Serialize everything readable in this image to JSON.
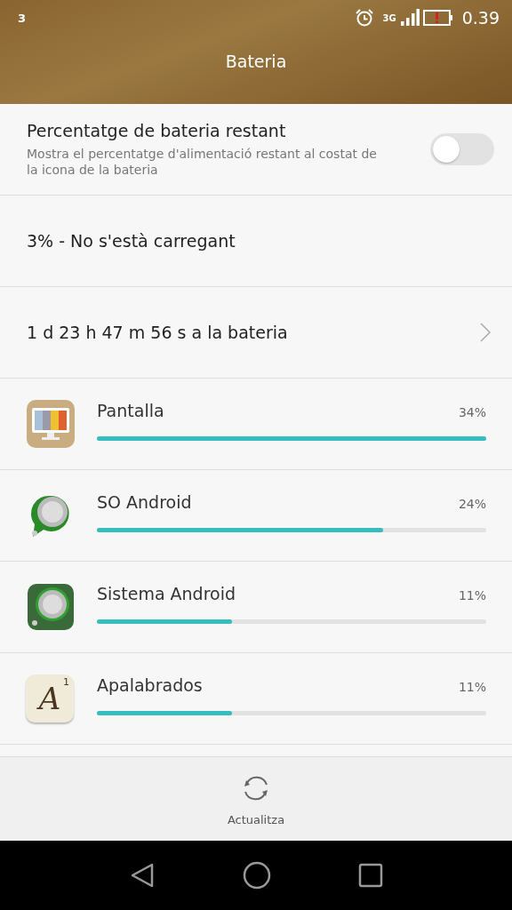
{
  "status_bar": {
    "notification": "3",
    "network": "3G",
    "time": "0.39"
  },
  "window": {
    "title": "Bateria"
  },
  "percentage_setting": {
    "title": "Percentatge de bateria restant",
    "description": "Mostra el percentatge d'alimentació restant al costat de la icona de la bateria",
    "on": false
  },
  "charge_status": "3% - No s'està carregant",
  "remaining_time": "1 d 23 h 47 m 56 s a la bateria",
  "apps": [
    {
      "name": "Pantalla",
      "percent": "34%",
      "level": 1.0,
      "kind": "monitor"
    },
    {
      "name": "SO Android",
      "percent": "24%",
      "level": 0.735,
      "kind": "disc-badge"
    },
    {
      "name": "Sistema Android",
      "percent": "11%",
      "level": 0.347,
      "kind": "disc-square"
    },
    {
      "name": "Apalabrados",
      "percent": "11%",
      "level": 0.347,
      "kind": "letter",
      "icon_letter": "A",
      "icon_mark": "1"
    }
  ],
  "bottom_action": {
    "label": "Actualitza"
  }
}
